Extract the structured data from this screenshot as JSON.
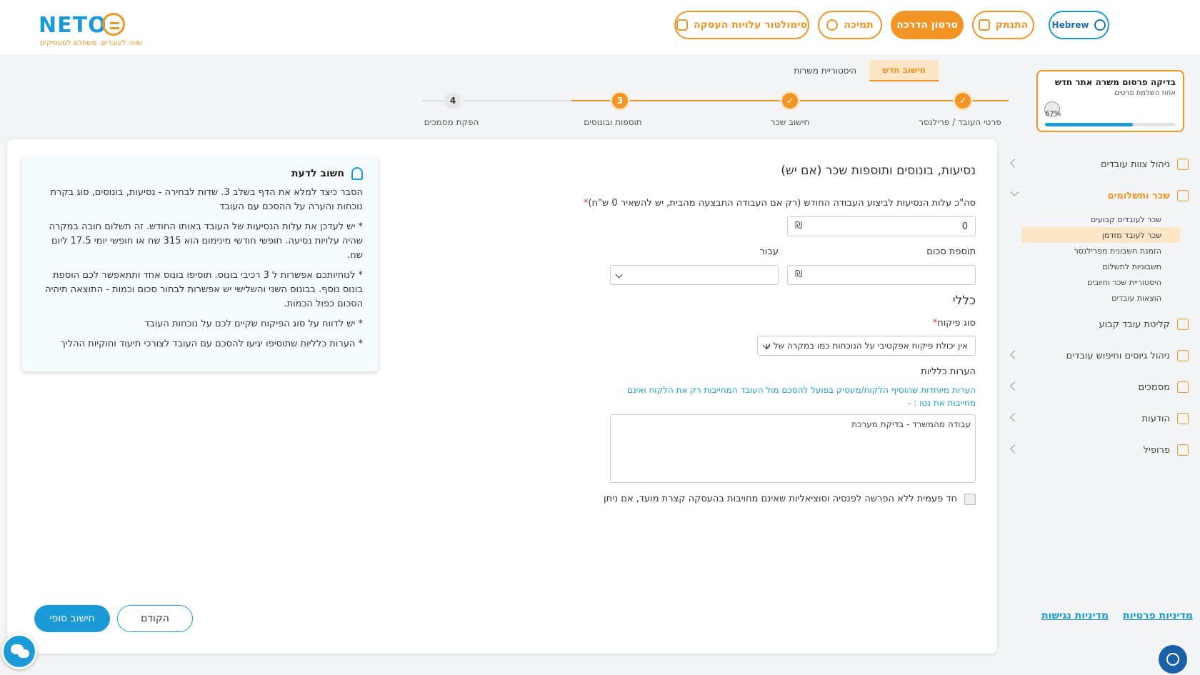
{
  "header": {
    "logo_text": "NETO",
    "logo_tagline": "שווה לעובדים. משתלם למעסיקים",
    "buttons": {
      "simulator": "סימולטור עלויות העסקה",
      "support": "תמיכה",
      "tutorial": "סרטון הדרכה",
      "logout": "התנתק",
      "language": "Hebrew"
    }
  },
  "progress_card": {
    "title": "בדיקה פרסום משרה אתר חדש",
    "subtitle": "אחוז השלמת פרטים",
    "percent_label": "67%",
    "percent_value": 0.67
  },
  "sidebar": {
    "items": [
      {
        "label": "ניהול צוות עובדים",
        "icon": "document-icon"
      },
      {
        "label": "שכר ותשלומים",
        "icon": "payroll-icon"
      },
      {
        "label": "קליטת עובד קבוע",
        "icon": "briefcase-icon"
      },
      {
        "label": "ניהול גיוסים וחיפוש עובדים",
        "icon": "grid-icon"
      },
      {
        "label": "מסמכים",
        "icon": "documents-icon"
      },
      {
        "label": "הודעות",
        "icon": "message-icon"
      },
      {
        "label": "פרופיל",
        "icon": "profile-icon"
      }
    ],
    "subitems": [
      "שכר לעובדים קבועים",
      "שכר לעובד מזדמן",
      "הזמנת חשבונית מפרילנסר",
      "חשבוניות לתשלום",
      "היסטוריית שכר וחיובים",
      "הוצאות עובדים"
    ],
    "policy_privacy": "מדיניות פרטיות",
    "policy_accessibility": "מדיניות נגישות"
  },
  "tabs": {
    "new_calc": "חישוב חדש",
    "history": "היסטוריית משרות"
  },
  "steps": [
    {
      "label": "פרטי העובד / פרילנסר",
      "marker": "✓"
    },
    {
      "label": "חישוב שכר",
      "marker": "✓"
    },
    {
      "label": "תוספות ובונוסים",
      "marker": "3"
    },
    {
      "label": "הפקת מסמכים",
      "marker": "4"
    }
  ],
  "form": {
    "title": "נסיעות, בונוסים ותוספות שכר (אם יש)",
    "travel_label": "סה\"כ עלות הנסיעות לביצוע העבודה החודש (רק אם העבודה התבצעה מהבית, יש להשאיר 0 ש\"ח)",
    "travel_value": "0",
    "currency": "₪",
    "bonus_amount_label": "תוספת סכום",
    "for_label": "עבור",
    "general_title": "כללי",
    "supervision_label": "סוג פיקוח",
    "supervision_value": "אין יכולת פיקוח אפקטיבי על הנוכחות כמו במקרה של עבוד",
    "notes_label": "הערות כלליות",
    "notes_hint": "הערות מיוחדות שהוסיף הלקוח/מעסיק בפועל להסכם מול העובד המחייבות רק את הלקוח ואינם מחייבות את נטו : -",
    "notes_value": "עבודה מהמשרד - בדיקת מערכת",
    "checkbox_label": "חד פעמית ללא הפרשה לפנסיה וסוציאליות שאינם מחויבות בהעסקה קצרת מועד, אם ניתן"
  },
  "info": {
    "title": "חשוב לדעת",
    "paragraphs": [
      "הסבר כיצד למלא את הדף בשלב 3. שדות לבחירה - נסיעות, בונוסים, סוג בקרת נוכחות והערה על ההסכם עם העובד",
      "* יש לעדכן את עלות הנסיעות של העובד באותו החודש. זה תשלום חובה במקרה שהיה עלויות נסיעה. חופשי חודשי מינימום הוא 315 שח או חופשי יומי 17.5 ליום שח.",
      "* לנוחיותכם אפשרות ל 3 רכיבי בונוס. תוסיפו בונוס אחד ותתאפשר לכם הוספת בונוס נוסף. בבונוס השני והשלישי יש אפשרות לבחור סכום וכמות - התוצאה תיהיה הסכום כפול הכמות.",
      "* יש לדווח על סוג הפיקוח שקיים לכם על נוכחות העובד",
      "* הערות כלליות שתוסיפו יגיעו להסכם עם העובד לצורכי תיעוד וחוקיות ההליך"
    ]
  },
  "buttons": {
    "final": "חישוב סופי",
    "prev": "הקודם"
  },
  "colors": {
    "brand_blue": "#1a9bd7",
    "brand_orange": "#f29524"
  }
}
